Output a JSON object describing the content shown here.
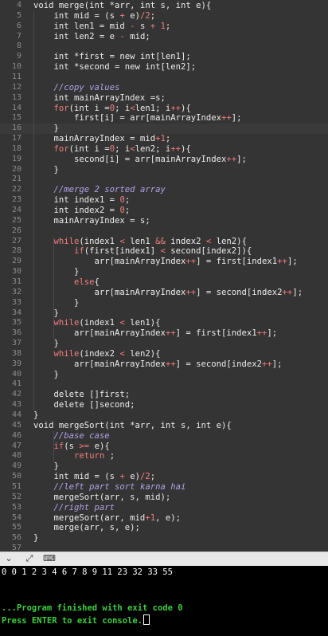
{
  "editor": {
    "lines": [
      {
        "n": "4",
        "t": "void merge(int *arr, int s, int e){"
      },
      {
        "n": "5",
        "t": "    int mid = (s + e)/2;"
      },
      {
        "n": "6",
        "t": "    int len1 = mid - s + 1;"
      },
      {
        "n": "7",
        "t": "    int len2 = e - mid;"
      },
      {
        "n": "8",
        "t": ""
      },
      {
        "n": "9",
        "t": "    int *first = new int[len1];"
      },
      {
        "n": "10",
        "t": "    int *second = new int[len2];"
      },
      {
        "n": "11",
        "t": ""
      },
      {
        "n": "12",
        "t": "    //copy values"
      },
      {
        "n": "13",
        "t": "    int mainArrayIndex =s;"
      },
      {
        "n": "14",
        "t": "    for(int i =0; i<len1; i++){"
      },
      {
        "n": "15",
        "t": "        first[i] = arr[mainArrayIndex++];"
      },
      {
        "n": "16",
        "t": "    }"
      },
      {
        "n": "17",
        "t": "    mainArrayIndex = mid+1;"
      },
      {
        "n": "18",
        "t": "    for(int i =0; i<len2; i++){"
      },
      {
        "n": "19",
        "t": "        second[i] = arr[mainArrayIndex++];"
      },
      {
        "n": "20",
        "t": "    }"
      },
      {
        "n": "21",
        "t": ""
      },
      {
        "n": "22",
        "t": "    //merge 2 sorted array"
      },
      {
        "n": "23",
        "t": "    int index1 = 0;"
      },
      {
        "n": "24",
        "t": "    int index2 = 0;"
      },
      {
        "n": "25",
        "t": "    mainArrayIndex = s;"
      },
      {
        "n": "26",
        "t": ""
      },
      {
        "n": "27",
        "t": "    while(index1 < len1 && index2 < len2){"
      },
      {
        "n": "28",
        "t": "        if(first[index1] < second[index2]){"
      },
      {
        "n": "29",
        "t": "            arr[mainArrayIndex++] = first[index1++];"
      },
      {
        "n": "30",
        "t": "        }"
      },
      {
        "n": "31",
        "t": "        else{"
      },
      {
        "n": "32",
        "t": "            arr[mainArrayIndex++] = second[index2++];"
      },
      {
        "n": "33",
        "t": "        }"
      },
      {
        "n": "34",
        "t": "    }"
      },
      {
        "n": "35",
        "t": "    while(index1 < len1){"
      },
      {
        "n": "36",
        "t": "        arr[mainArrayIndex++] = first[index1++];"
      },
      {
        "n": "37",
        "t": "    }"
      },
      {
        "n": "38",
        "t": "    while(index2 < len2){"
      },
      {
        "n": "39",
        "t": "        arr[mainArrayIndex++] = second[index2++];"
      },
      {
        "n": "40",
        "t": "    }"
      },
      {
        "n": "41",
        "t": ""
      },
      {
        "n": "42",
        "t": "    delete []first;"
      },
      {
        "n": "43",
        "t": "    delete []second;"
      },
      {
        "n": "44",
        "t": "}"
      },
      {
        "n": "45",
        "t": "void mergeSort(int *arr, int s, int e){"
      },
      {
        "n": "46",
        "t": "    //base case"
      },
      {
        "n": "47",
        "t": "    if(s >= e){"
      },
      {
        "n": "48",
        "t": "        return ;"
      },
      {
        "n": "49",
        "t": "    }"
      },
      {
        "n": "50",
        "t": "    int mid = (s + e)/2;"
      },
      {
        "n": "51",
        "t": "    //left part sort karna hai"
      },
      {
        "n": "52",
        "t": "    mergeSort(arr, s, mid);"
      },
      {
        "n": "53",
        "t": "    //right part"
      },
      {
        "n": "54",
        "t": "    mergeSort(arr, mid+1, e);"
      },
      {
        "n": "55",
        "t": "    merge(arr, s, e);"
      },
      {
        "n": "56",
        "t": "}"
      },
      {
        "n": "57",
        "t": ""
      }
    ],
    "active_line": "16"
  },
  "toolbar": {
    "icons": [
      "chevron-down-icon",
      "expand-icon",
      "terminal-input-icon"
    ]
  },
  "console": {
    "output": "0 0 1 2 3 4 6 7 8 9 11 23 32 33 55",
    "blank": "",
    "finished": "...Program finished with exit code 0",
    "prompt": "Press ENTER to exit console."
  },
  "colors": {
    "editor_bg": "#343434",
    "keyword": "#f07e7e",
    "comment": "#b3a2e6",
    "console_green": "#3ccf3c"
  }
}
